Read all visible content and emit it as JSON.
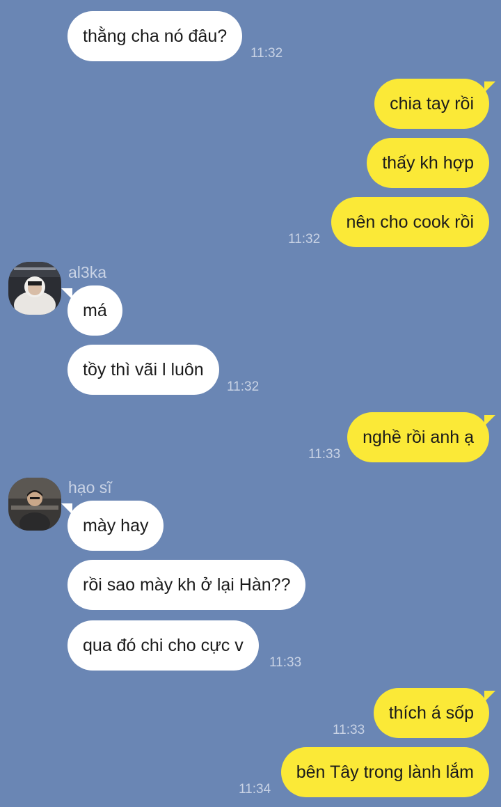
{
  "messages": [
    {
      "text": "thằng cha nó đâu?",
      "time": "11:32"
    },
    {
      "text": "chia tay rồi"
    },
    {
      "text": "thấy kh hợp"
    },
    {
      "text": "nên cho cook rồi",
      "time": "11:32"
    },
    {
      "sender": "al3ka",
      "avatar_icon": "user-avatar-al3ka",
      "text": "má"
    },
    {
      "text": "tồy thì vãi l luôn",
      "time": "11:32"
    },
    {
      "text": "nghề rồi anh ạ",
      "time": "11:33"
    },
    {
      "sender": "hạo sĩ",
      "avatar_icon": "user-avatar-hao-si",
      "text": "mày hay"
    },
    {
      "text": "rồi sao mày kh ở lại Hàn??"
    },
    {
      "text": "qua đó chi cho cực v",
      "time": "11:33"
    },
    {
      "text": "thích á sốp",
      "time": "11:33"
    },
    {
      "text": "bên Tây trong lành lắm",
      "time": "11:34"
    }
  ],
  "colors": {
    "background": "#6a86b4",
    "incoming_bubble": "#ffffff",
    "outgoing_bubble": "#fbe937",
    "meta_text": "#c9d3e5"
  }
}
